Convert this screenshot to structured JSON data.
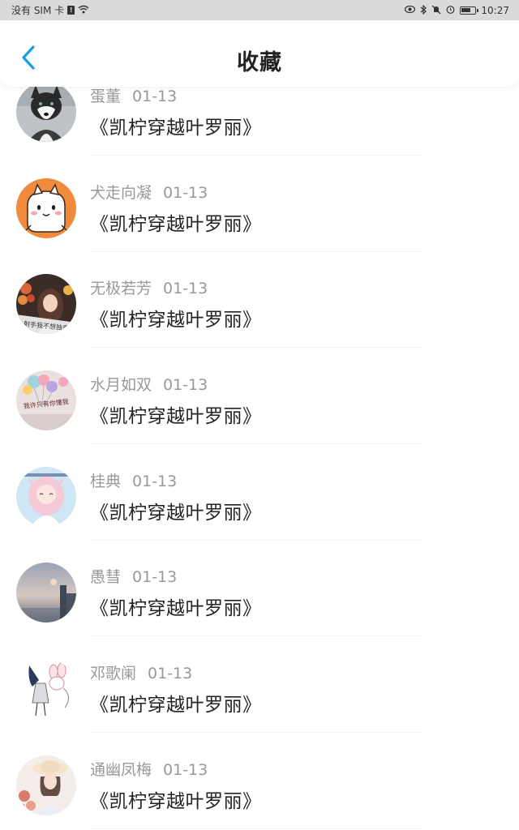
{
  "status_bar": {
    "carrier": "没有 SIM 卡",
    "sim_card_glyph": "!",
    "time": "10:27",
    "icons": [
      "eye-icon",
      "bluetooth-icon",
      "mute-icon",
      "alarm-icon",
      "battery-icon"
    ],
    "battery_level": 0.7
  },
  "header": {
    "title": "收藏",
    "back_icon": "chevron-left-icon",
    "accent_color": "#1a9ee8"
  },
  "items": [
    {
      "user": "蛋董",
      "date": "01-13",
      "title": "《凯柠穿越叶罗丽》",
      "avatar": "husky-dog-photo"
    },
    {
      "user": "犬走向凝",
      "date": "01-13",
      "title": "《凯柠穿越叶罗丽》",
      "avatar": "cartoon-cat-orange"
    },
    {
      "user": "无极若芳",
      "date": "01-13",
      "title": "《凯柠穿越叶罗丽》",
      "avatar": "girl-photo-flowers",
      "avatar_text": "射手我不想独奏"
    },
    {
      "user": "水月如双",
      "date": "01-13",
      "title": "《凯柠穿越叶罗丽》",
      "avatar": "balloons-text",
      "avatar_text": "我许只有你懂我"
    },
    {
      "user": "桂典",
      "date": "01-13",
      "title": "《凯柠穿越叶罗丽》",
      "avatar": "anime-pink-hair-girl"
    },
    {
      "user": "愚彗",
      "date": "01-13",
      "title": "《凯柠穿越叶罗丽》",
      "avatar": "misty-sky-tower"
    },
    {
      "user": "邓歌阑",
      "date": "01-13",
      "title": "《凯柠穿越叶罗丽》",
      "avatar": "sketch-girl-rabbit"
    },
    {
      "user": "通幽凤梅",
      "date": "01-13",
      "title": "《凯柠穿越叶罗丽》",
      "avatar": "girl-with-hat-photo"
    }
  ]
}
